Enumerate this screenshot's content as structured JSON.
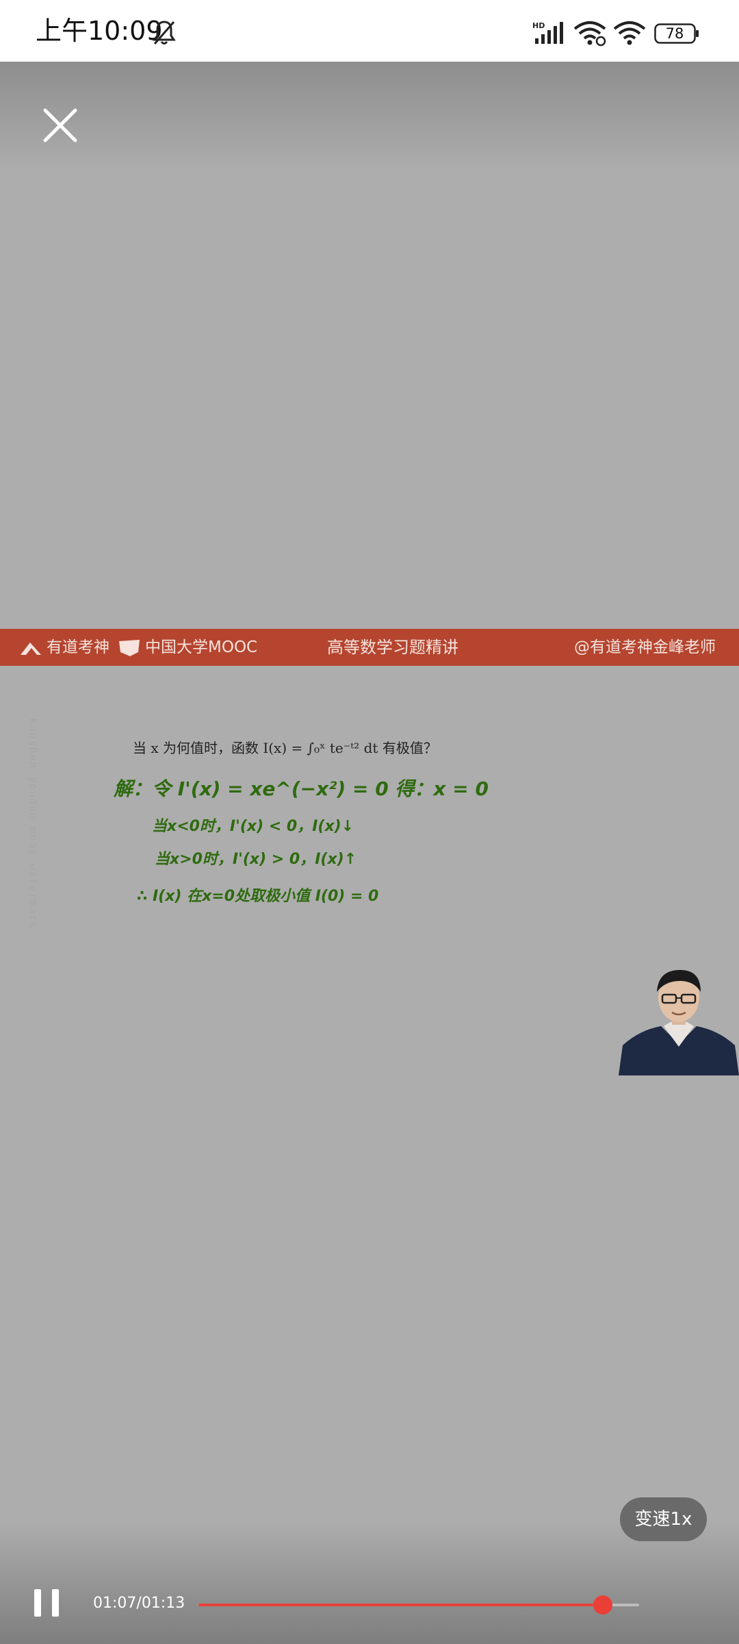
{
  "status_bar": {
    "time": "上午10:09",
    "battery": "78"
  },
  "icons": {
    "close": "close-icon",
    "bell_off": "bell-off-icon",
    "signal": "hd-signal-icon",
    "wifi": "wifi-icon",
    "battery": "battery-icon",
    "pause": "pause-icon"
  },
  "video": {
    "banner": {
      "brand1": "有道考神",
      "brand2": "中国大学MOOC",
      "course_title": "高等数学习题精讲",
      "teacher_tag": "@有道考神金峰老师"
    },
    "question": "当 x 为何值时，函数 I(x) = ∫₀ˣ te⁻ᵗ² dt 有极值？",
    "solution": [
      "解：令 I'(x) = xe^(−x²) = 0  得：x = 0",
      "当x<0时，I'(x) < 0，I(x)↓",
      "当x>0时，I'(x) > 0，I(x)↑",
      "∴ I(x) 在x=0处取极小值 I(0) = 0"
    ]
  },
  "controls": {
    "speed_label": "变速1x",
    "time": "01:07/01:13",
    "progress": 0.9178
  },
  "colors": {
    "banner": "#b5452f",
    "progress": "#e8433b",
    "handwriting": "#2e6b0f"
  }
}
